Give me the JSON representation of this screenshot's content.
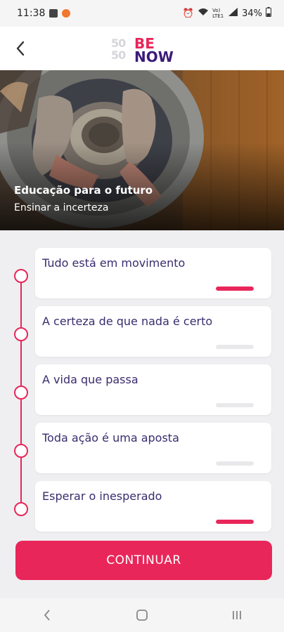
{
  "status_bar": {
    "time": "11:38",
    "battery": "34%",
    "network": "Vo) LTE1"
  },
  "header": {
    "back_icon": "chevron-left-icon",
    "logo": {
      "fifty_top": "50",
      "fifty_bottom": "50",
      "be": "BE",
      "now": "NOW"
    }
  },
  "hero": {
    "title": "Educação para o futuro",
    "subtitle": "Ensinar a incerteza"
  },
  "lessons": [
    {
      "label": "Tudo está em movimento",
      "progress": 1.0
    },
    {
      "label": "A certeza de que nada é certo",
      "progress": 0.0
    },
    {
      "label": "A vida que passa",
      "progress": 0.0
    },
    {
      "label": "Toda ação é uma aposta",
      "progress": 0.0
    },
    {
      "label": "Esperar o inesperado",
      "progress": 1.0
    }
  ],
  "continue_label": "CONTINUAR",
  "colors": {
    "accent": "#e8265a",
    "text_purple": "#3a2c6e",
    "brand_purple": "#3b1b7a"
  }
}
